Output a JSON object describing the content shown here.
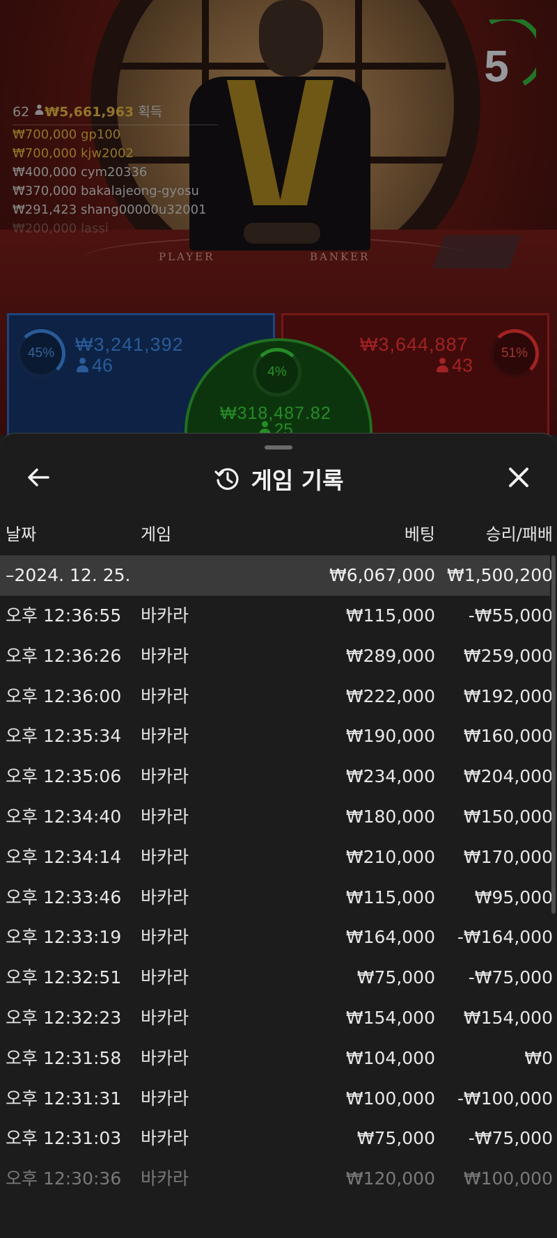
{
  "timer": {
    "value": "5"
  },
  "winners": {
    "count": "62",
    "total": "₩5,661,963",
    "suffix": "획득",
    "list": [
      {
        "amount": "₩700,000",
        "name": "gp100"
      },
      {
        "amount": "₩700,000",
        "name": "kjw2002"
      },
      {
        "amount": "₩400,000",
        "name": "cym20336"
      },
      {
        "amount": "₩370,000",
        "name": "bakalajeong-gyosu"
      },
      {
        "amount": "₩291,423",
        "name": "shang00000u32001"
      },
      {
        "amount": "₩200,000",
        "name": "lassi"
      }
    ]
  },
  "table": {
    "player_label": "PLAYER",
    "banker_label": "BANKER"
  },
  "bets": {
    "player": {
      "percent": "45%",
      "amount": "₩3,241,392",
      "count": "46"
    },
    "banker": {
      "percent": "51%",
      "amount": "₩3,644,887",
      "count": "43"
    },
    "tie": {
      "percent": "4%",
      "amount": "₩318,487.82",
      "count": "25"
    }
  },
  "sheet": {
    "title": "게임 기록",
    "columns": {
      "date": "날짜",
      "game": "게임",
      "bet": "베팅",
      "result": "승리/패배"
    },
    "date_group": {
      "date": "–2024. 12. 25.",
      "bet": "₩6,067,000",
      "result": "₩1,500,200"
    },
    "rows": [
      {
        "time": "오후 12:36:55",
        "game": "바카라",
        "bet": "₩115,000",
        "result": "-₩55,000"
      },
      {
        "time": "오후 12:36:26",
        "game": "바카라",
        "bet": "₩289,000",
        "result": "₩259,000"
      },
      {
        "time": "오후 12:36:00",
        "game": "바카라",
        "bet": "₩222,000",
        "result": "₩192,000"
      },
      {
        "time": "오후 12:35:34",
        "game": "바카라",
        "bet": "₩190,000",
        "result": "₩160,000"
      },
      {
        "time": "오후 12:35:06",
        "game": "바카라",
        "bet": "₩234,000",
        "result": "₩204,000"
      },
      {
        "time": "오후 12:34:40",
        "game": "바카라",
        "bet": "₩180,000",
        "result": "₩150,000"
      },
      {
        "time": "오후 12:34:14",
        "game": "바카라",
        "bet": "₩210,000",
        "result": "₩170,000"
      },
      {
        "time": "오후 12:33:46",
        "game": "바카라",
        "bet": "₩115,000",
        "result": "₩95,000"
      },
      {
        "time": "오후 12:33:19",
        "game": "바카라",
        "bet": "₩164,000",
        "result": "-₩164,000"
      },
      {
        "time": "오후 12:32:51",
        "game": "바카라",
        "bet": "₩75,000",
        "result": "-₩75,000"
      },
      {
        "time": "오후 12:32:23",
        "game": "바카라",
        "bet": "₩154,000",
        "result": "₩154,000"
      },
      {
        "time": "오후 12:31:58",
        "game": "바카라",
        "bet": "₩104,000",
        "result": "₩0"
      },
      {
        "time": "오후 12:31:31",
        "game": "바카라",
        "bet": "₩100,000",
        "result": "-₩100,000"
      },
      {
        "time": "오후 12:31:03",
        "game": "바카라",
        "bet": "₩75,000",
        "result": "-₩75,000"
      },
      {
        "time": "오후 12:30:36",
        "game": "바카라",
        "bet": "₩120,000",
        "result": "₩100,000"
      }
    ]
  },
  "colors": {
    "player": "#3a7fd6",
    "banker": "#e03030",
    "tie": "#35c235",
    "gold": "#c9a23a"
  }
}
